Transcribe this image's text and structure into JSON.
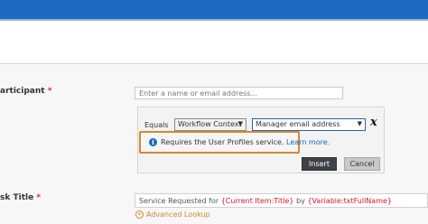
{
  "form": {
    "participant_label": "articipant",
    "required_marker": "*",
    "participant_placeholder": "Enter a name or email address...",
    "lookup": {
      "operator": "Equals",
      "source_select": "Workflow Context",
      "field_select": "Manager email address",
      "clear_icon": "x-icon",
      "notice": {
        "icon": "info-icon",
        "text": "Requires the User Profiles service.",
        "link": "Learn more."
      },
      "insert_button": "Insert",
      "cancel_button": "Cancel"
    },
    "task_title_label": "sk Title",
    "task_title_value": {
      "prefix": "Service Requested for ",
      "token1": "{Current Item:Title}",
      "middle": " by ",
      "token2": "{Variable:txtFullName}"
    },
    "advanced_lookup": "Advanced Lookup"
  },
  "colors": {
    "top_bar": "#1f69c3",
    "notice_border": "#d28b2c",
    "required": "#d92b2b",
    "token": "#d0182c",
    "link": "#1b63b8"
  }
}
